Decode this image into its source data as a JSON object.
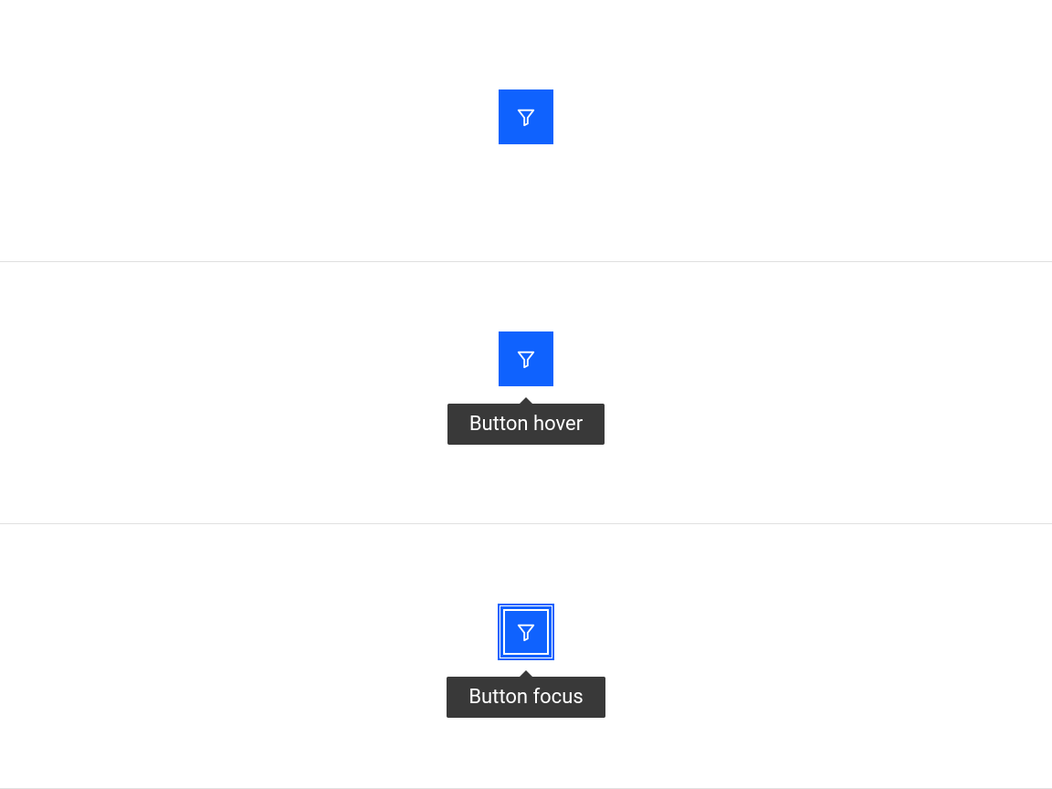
{
  "button_states": [
    {
      "state": "default",
      "tooltip": null
    },
    {
      "state": "hover",
      "tooltip": "Button hover"
    },
    {
      "state": "focus",
      "tooltip": "Button focus"
    }
  ],
  "icon_name": "filter",
  "colors": {
    "primary": "#0f62fe",
    "tooltip_bg": "#393939",
    "tooltip_fg": "#ffffff"
  }
}
